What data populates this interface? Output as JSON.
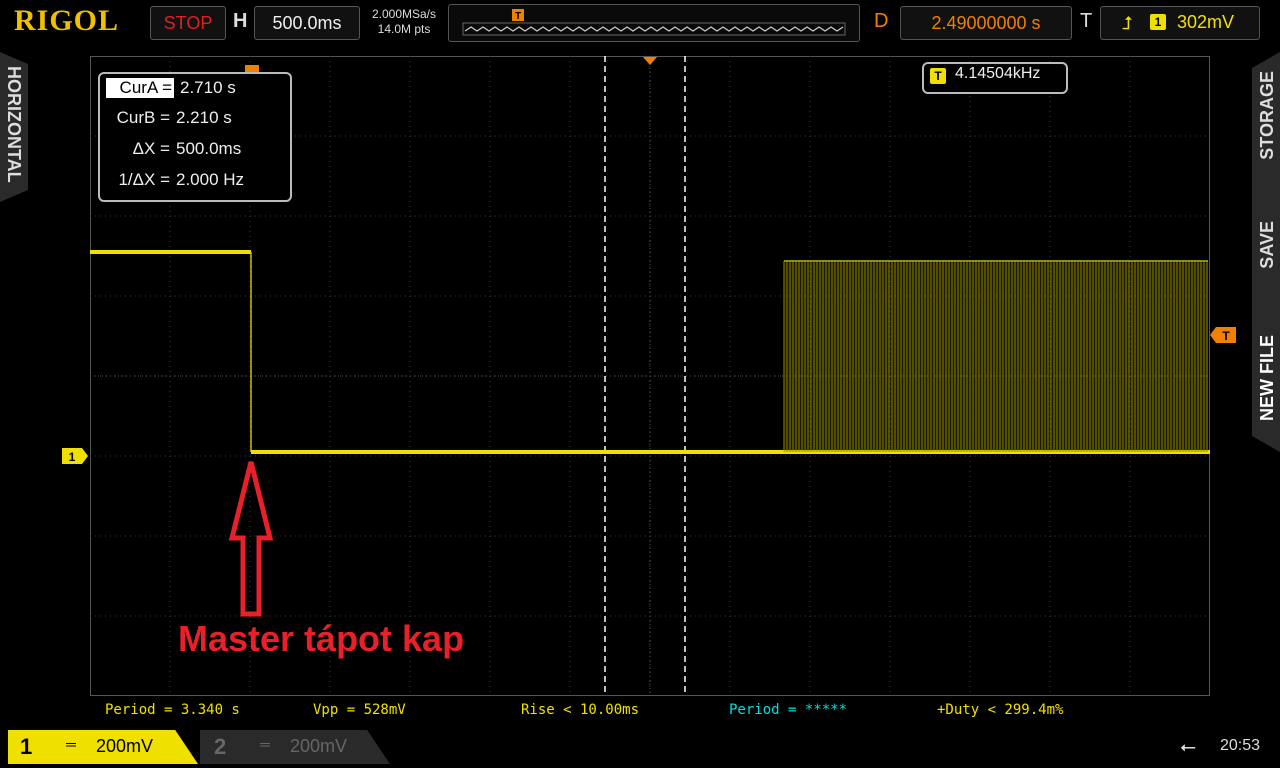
{
  "brand": "RIGOL",
  "top": {
    "run_state": "STOP",
    "h_label": "H",
    "timebase": "500.0ms",
    "sample_rate": "2.000MSa/s",
    "memory_depth": "14.0M pts",
    "d_label": "D",
    "delay": "2.49000000 s",
    "t_label": "T",
    "trigger_level": "302mV",
    "trigger_channel": "1"
  },
  "side_tabs": {
    "left": "HORIZONTAL",
    "right": [
      "STORAGE",
      "SAVE",
      "NEW FILE"
    ]
  },
  "cursor": {
    "rows": [
      {
        "label": "CurA =",
        "value": "2.710 s"
      },
      {
        "label": "CurB =",
        "value": "2.210 s"
      },
      {
        "label": "ΔX =",
        "value": "500.0ms"
      },
      {
        "label": "1/ΔX =",
        "value": "2.000 Hz"
      }
    ]
  },
  "trigger_freq": "4.14504kHz",
  "markers": {
    "trigger": "T",
    "channel": "1"
  },
  "measurements": [
    {
      "text": "Period = 3.340 s",
      "color": "#f0e000"
    },
    {
      "text": "Vpp = 528mV",
      "color": "#f0e000"
    },
    {
      "text": "Rise < 10.00ms",
      "color": "#f0e000"
    },
    {
      "text": "Period = *****",
      "color": "#00e0e0"
    },
    {
      "text": "+Duty < 299.4m%",
      "color": "#f0e000"
    }
  ],
  "channels": [
    {
      "num": "1",
      "scale": "200mV"
    },
    {
      "num": "2",
      "scale": "200mV"
    }
  ],
  "clock": "20:53",
  "annotation": "Master tápot kap",
  "colors": {
    "ch1": "#f0e000",
    "annotation": "#e8202a",
    "accent": "#f08000"
  }
}
